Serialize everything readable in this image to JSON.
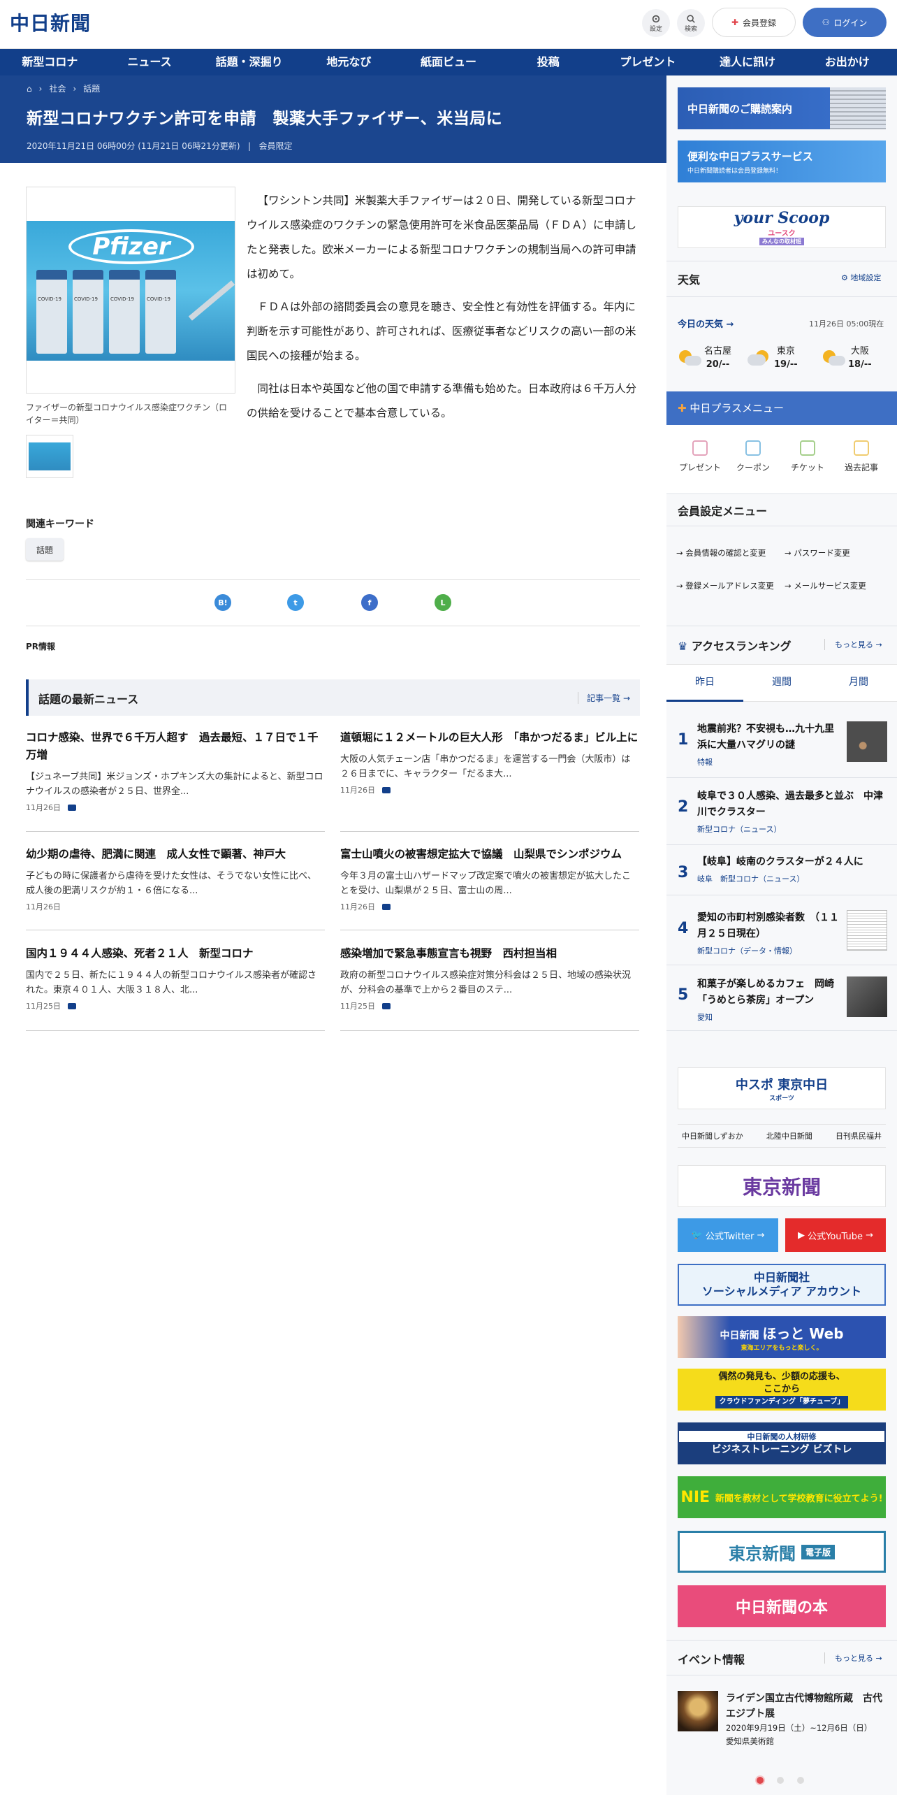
{
  "header": {
    "logo": "中日新聞",
    "settings_label": "設定",
    "search_label": "検索",
    "register_label": "会員登録",
    "login_label": "ログイン"
  },
  "nav": [
    "新型コロナ",
    "ニュース",
    "話題・深掘り",
    "地元なび",
    "紙面ビュー",
    "投稿",
    "プレゼント",
    "達人に訊け",
    "お出かけ"
  ],
  "breadcrumb": [
    "社会",
    "話題"
  ],
  "article": {
    "title": "新型コロナワクチン許可を申請　製薬大手ファイザー、米当局に",
    "date": "2020年11月21日 06時00分 (11月21日 06時21分更新)",
    "members_only": "会員限定",
    "photo_text": "Pfizer",
    "vial_label": "COVID-19",
    "caption": "ファイザーの新型コロナウイルス感染症ワクチン（ロイター＝共同）",
    "paragraphs": [
      "【ワシントン共同】米製薬大手ファイザーは２０日、開発している新型コロナウイルス感染症のワクチンの緊急使用許可を米食品医薬品局（ＦＤＡ）に申請したと発表した。欧米メーカーによる新型コロナワクチンの規制当局への許可申請は初めて。",
      "ＦＤＡは外部の諮問委員会の意見を聴き、安全性と有効性を評価する。年内に判断を示す可能性があり、許可されれば、医療従事者などリスクの高い一部の米国民への接種が始まる。",
      "同社は日本や英国など他の国で申請する準備も始めた。日本政府は６千万人分の供給を受けることで基本合意している。"
    ]
  },
  "keywords": {
    "heading": "関連キーワード",
    "tags": [
      "話題"
    ]
  },
  "share": {
    "hatena": "B!",
    "twitter": "t",
    "facebook": "f",
    "line": "L"
  },
  "pr_label": "PR情報",
  "latest": {
    "heading": "話題の最新ニュース",
    "more": "記事一覧",
    "items": [
      {
        "title": "コロナ感染、世界で６千万人超す　過去最短、１７日で１千万増",
        "body": "【ジュネーブ共同】米ジョンズ・ホプキンズ大の集計によると、新型コロナウイルスの感染者が２５日、世界全...",
        "date": "11月26日"
      },
      {
        "title": "道頓堀に１２メートルの巨大人形　「串かつだるま」ビル上に",
        "body": "大阪の人気チェーン店「串かつだるま」を運営する一門会（大阪市）は２６日までに、キャラクター「だるま大...",
        "date": "11月26日"
      },
      {
        "title": "幼少期の虐待、肥満に関連　成人女性で顕著、神戸大",
        "body": "子どもの時に保護者から虐待を受けた女性は、そうでない女性に比べ、成人後の肥満リスクが約１・６倍になる...",
        "date": "11月26日"
      },
      {
        "title": "富士山噴火の被害想定拡大で協議　山梨県でシンポジウム",
        "body": "今年３月の富士山ハザードマップ改定案で噴火の被害想定が拡大したことを受け、山梨県が２５日、富士山の周...",
        "date": "11月26日"
      },
      {
        "title": "国内１９４４人感染、死者２１人　新型コロナ",
        "body": "国内で２５日、新たに１９４４人の新型コロナウイルス感染者が確認された。東京４０１人、大阪３１８人、北...",
        "date": "11月25日"
      },
      {
        "title": "感染増加で緊急事態宣言も視野　西村担当相",
        "body": "政府の新型コロナウイルス感染症対策分科会は２５日、地域の感染状況が、分科会の基準で上から２番目のステ...",
        "date": "11月25日"
      }
    ]
  },
  "sidebar": {
    "banner1": "中日新聞のご購読案内",
    "banner2": "便利な中日プラスサービス",
    "banner2_sub": "中日新聞購読者は会員登録無料！",
    "banner3": "your Scoop",
    "banner3_sub": "ユースク",
    "banner3_tag": "みんなの取材班",
    "weather": {
      "heading": "天気",
      "region_settings": "地域設定",
      "today": "今日の天気",
      "updated": "11月26日 05:00現在",
      "cities": [
        {
          "name": "名古屋",
          "temp": "20/--"
        },
        {
          "name": "東京",
          "temp": "19/--"
        },
        {
          "name": "大阪",
          "temp": "18/--"
        }
      ]
    },
    "plus_menu": {
      "heading": "中日プラスメニュー",
      "items": [
        "プレゼント",
        "クーポン",
        "チケット",
        "過去記事"
      ]
    },
    "member_menu": {
      "heading": "会員設定メニュー",
      "links": [
        "会員情報の確認と変更",
        "パスワード変更",
        "登録メールアドレス変更",
        "メールサービス変更"
      ]
    },
    "ranking": {
      "heading": "アクセスランキング",
      "more": "もっと見る",
      "tabs": [
        "昨日",
        "週間",
        "月間"
      ],
      "items": [
        {
          "no": "1",
          "title": "地震前兆？不安視も…九十九里浜に大量ハマグリの謎",
          "tag": "特報"
        },
        {
          "no": "2",
          "title": "岐阜で３０人感染、過去最多と並ぶ　中津川でクラスター",
          "tag": "新型コロナ（ニュース）"
        },
        {
          "no": "3",
          "title": "【岐阜】岐南のクラスターが２４人に",
          "tag": "岐阜　新型コロナ（ニュース）"
        },
        {
          "no": "4",
          "title": "愛知の市町村別感染者数　（１１月２５日現在）",
          "tag": "新型コロナ（データ・情報）"
        },
        {
          "no": "5",
          "title": "和菓子が楽しめるカフェ　岡崎「うめとら茶房」オープン",
          "tag": "愛知"
        }
      ]
    },
    "chuspo": "中スポ 東京中日",
    "chuspo_sub": "スポーツ",
    "links": [
      "中日新聞しずおか",
      "北陸中日新聞",
      "日刊県民福井"
    ],
    "tokyo": "東京新聞",
    "twitter_btn": "公式Twitter",
    "youtube_btn": "公式YouTube",
    "social1": "中日新聞社",
    "social2": "ソーシャルメディア アカウント",
    "hotto1": "中日新聞",
    "hotto2": "ほっと Web",
    "hotto_sub": "東海エリアをもっと楽しく。",
    "yume1": "偶然の発見も、少額の応援も、",
    "yume2": "ここから",
    "yume3": "クラウドファンディング「夢チューブ」",
    "bizo1": "中日新聞の人材研修",
    "bizo2": "ビジネストレーニング ビズトレ",
    "nie1": "NIE",
    "nie2": "新聞を教材として学校教育に役立てよう!",
    "tokyo_e": "東京新聞",
    "tokyo_e_tag": "電子版",
    "books": "中日新聞の本",
    "events": {
      "heading": "イベント情報",
      "more": "もっと見る",
      "title": "ライデン国立古代博物館所蔵　古代エジプト展",
      "dates": "2020年9月19日（土）~12月6日（日）",
      "venue": "愛知県美術館"
    }
  }
}
